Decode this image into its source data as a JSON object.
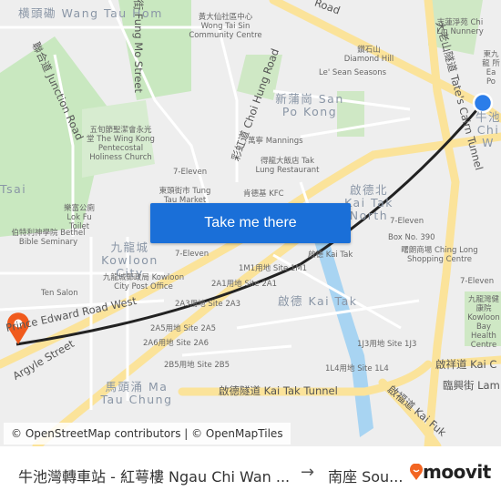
{
  "map": {
    "labels": [
      "横頭磡 Wang Tau Hom",
      "舞街 Fung Mo Street",
      "黃大仙社區中心 Wong Tai Sin Community Centre",
      "聯合道 Junction Road",
      "彩虹道 Choi Hung Road",
      "五旬節聖潔會永光堂 The Wing Kong Pentecostal Holiness Church",
      "7-Eleven",
      "東頭街市 Tung Tau Market",
      "樂富公廁 Lok Fu Toilet",
      "伯特利神學院 Bethel Bible Seminary",
      "Tsai",
      "九龍城 Kowloon City",
      "7-Eleven",
      "九龍城郵政局 Kowloon City Post Office",
      "Ten Salon",
      "Prince Edward Road West",
      "Argyle Street",
      "馬頭涌 Ma Tau Chung",
      "1M1用地 Site 1M1",
      "2A1用地 Site 2A1",
      "2A3用地 Site 2A3",
      "2A5用地 Site 2A5",
      "2A6用地 Site 2A6",
      "2B5用地 Site 2B5",
      "Road",
      "志蓮淨苑 Chi Lin Nunnery",
      "鑽石山 Diamond Hill",
      "Le' Sean Seasons",
      "新蒲崗 San Po Kong",
      "大老山隧道 Tate's Cairn Tunnel",
      "萬寧 Mannings",
      "得龍大飯店 Tak Lung Restaurant",
      "肯德基 KFC",
      "啟德北 Kai Tak North",
      "7-Eleven",
      "Box No. 390",
      "啟德 Kai Tak",
      "曙朗商場 Ching Long Shopping Centre",
      "啟德 Kai Tak",
      "7-Eleven",
      "九龍灣健康院 Kowloon Bay Health Centre",
      "1J3用地 Site 1J3",
      "1L4用地 Site 1L4",
      "啟德隧道 Kai Tak Tunnel",
      "啟祥道 Kai C",
      "臨興街 Lam",
      "啟福道 Kai Fuk",
      "東九龍 所 Ea Po",
      "牛池 Chi W"
    ],
    "route_color": "#222222",
    "origin_color": "#2b7de9",
    "destination_color": "#f05a1c"
  },
  "cta": {
    "label": "Take me there"
  },
  "attribution": "© OpenStreetMap contributors | © OpenMapTiles",
  "footer": {
    "from": "牛池灣轉車站 - 紅萼樓 Ngau Chi Wan ...",
    "arrow": "→",
    "to": "南座 Sou...",
    "brand": "moovit",
    "brand_color": "#f26522"
  }
}
